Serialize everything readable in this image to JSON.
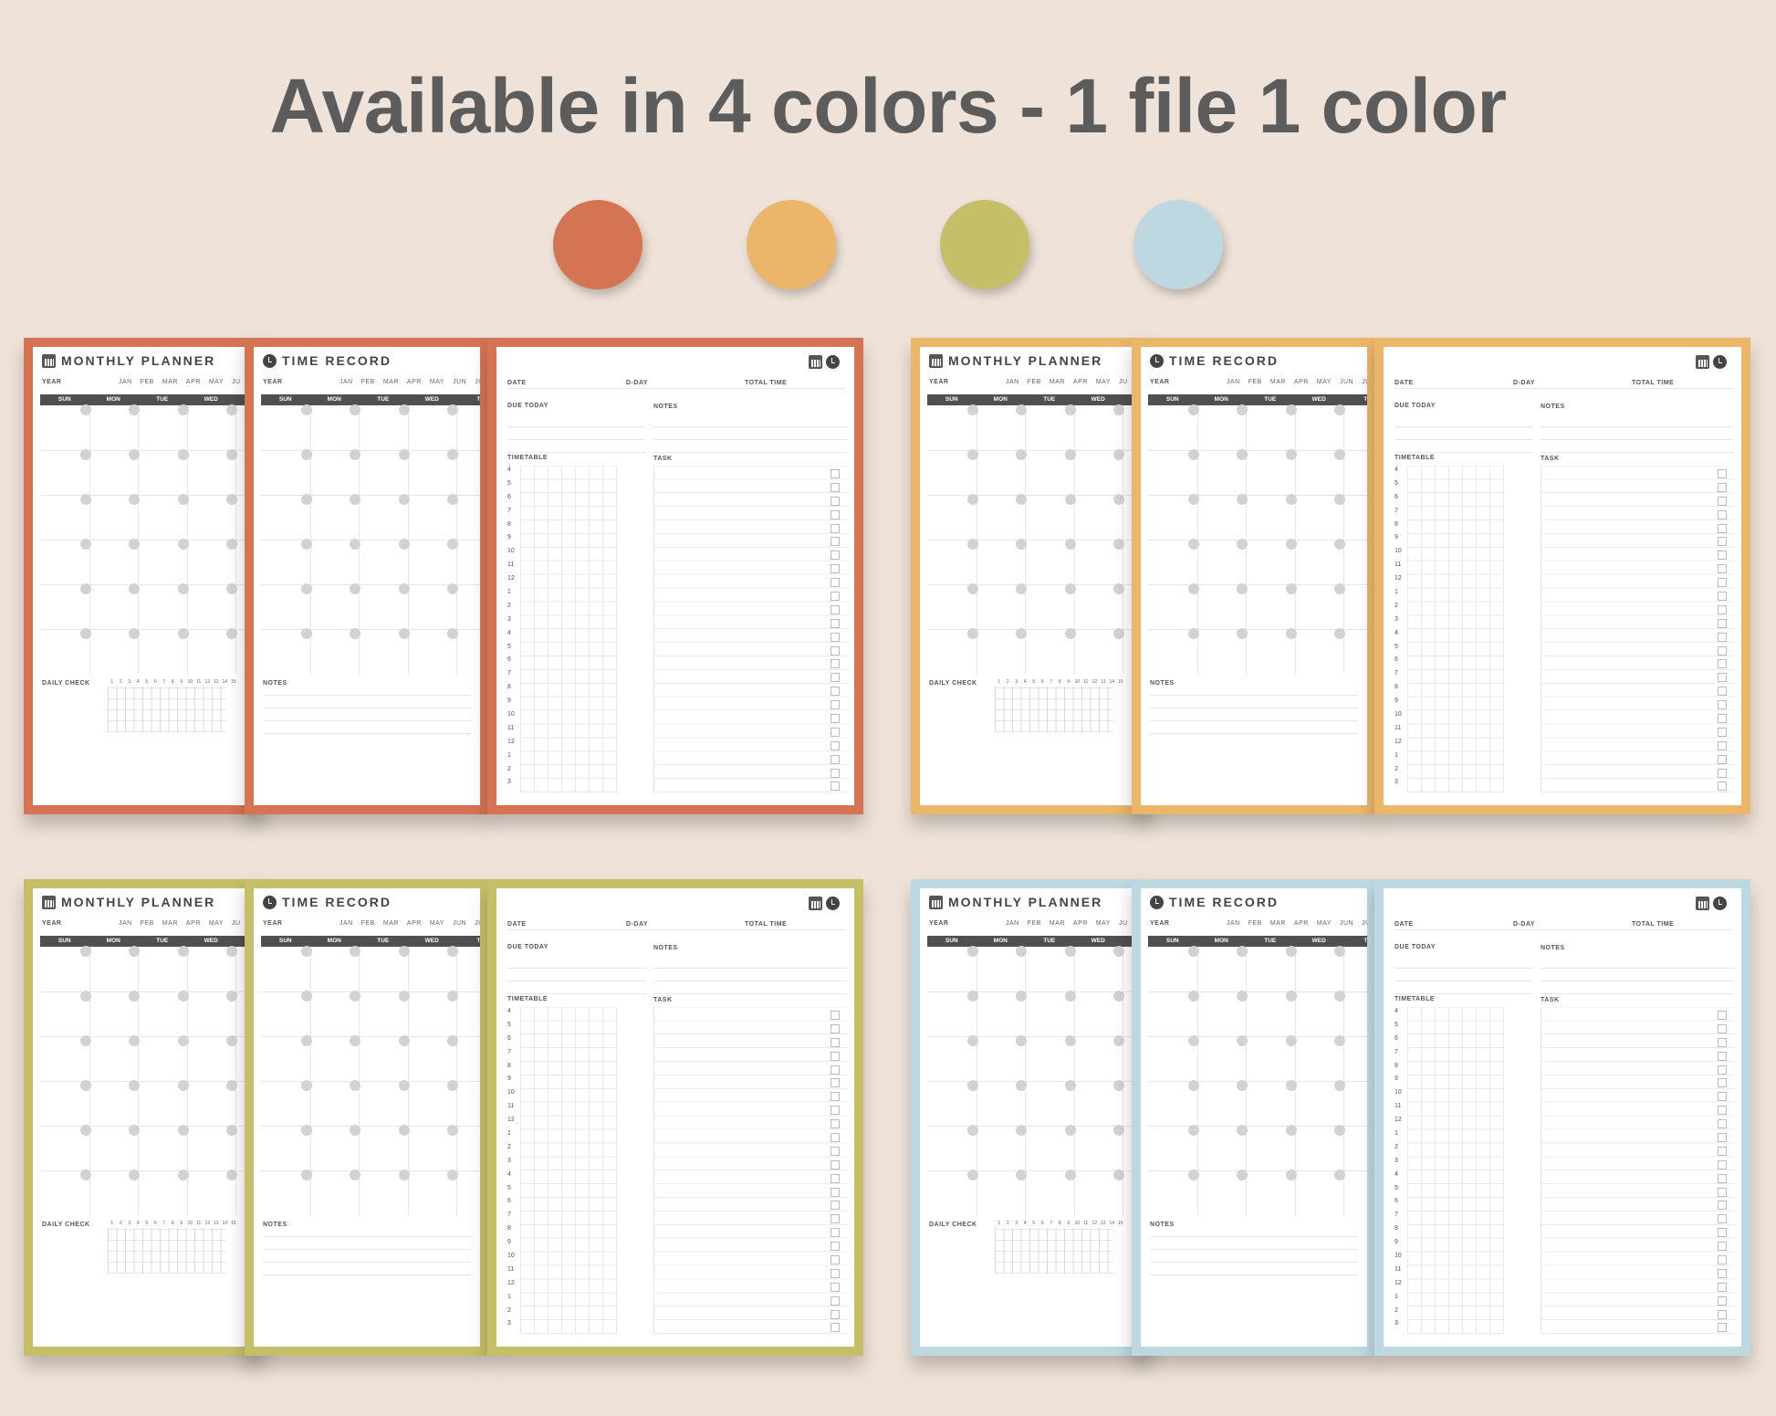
{
  "headline": "Available in 4 colors - 1 file 1 color",
  "colors": [
    {
      "name": "terracotta",
      "hex": "#d57453"
    },
    {
      "name": "mustard",
      "hex": "#ebb56a"
    },
    {
      "name": "olive",
      "hex": "#c6bf69"
    },
    {
      "name": "light-blue",
      "hex": "#bed8e1"
    }
  ],
  "monthly_planner": {
    "title": "MONTHLY PLANNER",
    "icon": "calendar-icon",
    "year_label": "YEAR",
    "months": [
      "JAN",
      "FEB",
      "MAR",
      "APR",
      "MAY",
      "JU"
    ],
    "weekdays": [
      "SUN",
      "MON",
      "TUE",
      "WED"
    ],
    "bottom_label": "DAILY CHECK",
    "daily_numbers": [
      "1",
      "2",
      "3",
      "4",
      "5",
      "6",
      "7",
      "8",
      "9",
      "10",
      "11",
      "12",
      "13",
      "14",
      "15"
    ]
  },
  "time_record": {
    "title": "TIME RECORD",
    "icon": "clock-icon",
    "year_label": "YEAR",
    "months": [
      "JAN",
      "FEB",
      "MAR",
      "APR",
      "MAY",
      "JUN",
      "JU"
    ],
    "weekdays": [
      "SUN",
      "MON",
      "TUE",
      "WED",
      "TH"
    ],
    "bottom_label": "NOTES"
  },
  "daily_page": {
    "icons": [
      "calendar-icon",
      "clock-icon"
    ],
    "date_label": "DATE",
    "dday_label": "D-DAY",
    "total_label": "TOTAL TIME",
    "due_label": "DUE TODAY",
    "notes_label": "NOTES",
    "timetable_label": "TIMETABLE",
    "task_label": "TASK",
    "hours": [
      "4",
      "5",
      "6",
      "7",
      "8",
      "9",
      "10",
      "11",
      "12",
      "1",
      "2",
      "3",
      "4",
      "5",
      "6",
      "7",
      "8",
      "9",
      "10",
      "11",
      "12",
      "1",
      "2",
      "3"
    ]
  }
}
